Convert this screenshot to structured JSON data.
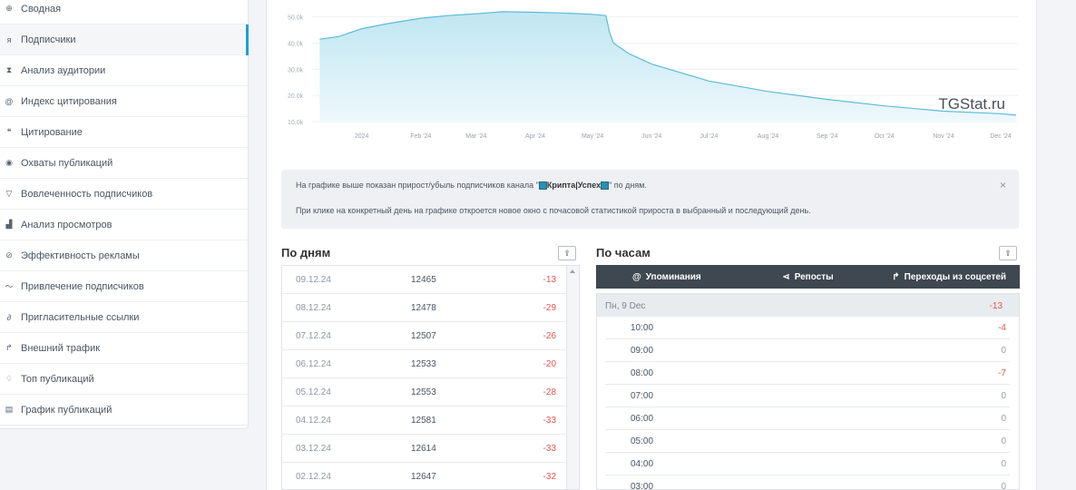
{
  "sidebar": {
    "items": [
      {
        "label": "Сводная",
        "icon": "dashboard-icon"
      },
      {
        "label": "Подписчики",
        "icon": "users-icon"
      },
      {
        "label": "Анализ аудитории",
        "icon": "hourglass-icon"
      },
      {
        "label": "Индекс цитирования",
        "icon": "at-icon"
      },
      {
        "label": "Цитирование",
        "icon": "quote-icon"
      },
      {
        "label": "Охваты публикаций",
        "icon": "eye-icon"
      },
      {
        "label": "Вовлеченность подписчиков",
        "icon": "filter-icon"
      },
      {
        "label": "Анализ просмотров",
        "icon": "bar-chart-icon"
      },
      {
        "label": "Эффективность рекламы",
        "icon": "tag-icon"
      },
      {
        "label": "Привлечение подписчиков",
        "icon": "trend-icon"
      },
      {
        "label": "Пригласительные ссылки",
        "icon": "link-icon"
      },
      {
        "label": "Внешний трафик",
        "icon": "share-arrow-icon"
      },
      {
        "label": "Топ публикаций",
        "icon": "thumbs-up-icon"
      },
      {
        "label": "График публикаций",
        "icon": "calendar-icon"
      }
    ]
  },
  "chart_data": {
    "type": "area",
    "x": [
      "2023-12-10",
      "2023-12-20",
      "2024-01-01",
      "2024-01-15",
      "2024-02-01",
      "2024-02-15",
      "2024-03-01",
      "2024-03-15",
      "2024-04-01",
      "2024-04-15",
      "2024-05-01",
      "2024-05-08",
      "2024-05-10",
      "2024-05-12",
      "2024-05-20",
      "2024-06-01",
      "2024-07-01",
      "2024-08-01",
      "2024-09-01",
      "2024-10-01",
      "2024-11-01",
      "2024-12-01",
      "2024-12-09"
    ],
    "y": [
      41500,
      42500,
      45500,
      47500,
      49500,
      50500,
      51200,
      52000,
      51800,
      51500,
      51000,
      50500,
      44000,
      40000,
      36000,
      32000,
      25500,
      21500,
      18500,
      16000,
      14000,
      13000,
      12465
    ],
    "ylim": [
      10000,
      53000
    ],
    "y_ticks": [
      "50.0k",
      "40.0k",
      "30.0k",
      "20.0k",
      "10.0k"
    ],
    "y_tick_values": [
      50000,
      40000,
      30000,
      20000,
      10000
    ],
    "x_ticks": [
      "2024",
      "Feb '24",
      "Mar '24",
      "Apr '24",
      "May '24",
      "Jun '24",
      "Jul '24",
      "Aug '24",
      "Sep '24",
      "Oct '24",
      "Nov '24",
      "Dec '24"
    ],
    "x_tick_dates": [
      "2024-01-01",
      "2024-02-01",
      "2024-03-01",
      "2024-04-01",
      "2024-05-01",
      "2024-06-01",
      "2024-07-01",
      "2024-08-01",
      "2024-09-01",
      "2024-10-01",
      "2024-11-01",
      "2024-12-01"
    ],
    "watermark": "TGStat.ru",
    "line_color": "#5bbcd9",
    "fill_color": "#bfe6f2",
    "grid": true
  },
  "info": {
    "line1_prefix": "На графике выше показан прирост/убыль подписчиков канала \"",
    "channel": "Крипта|Успех",
    "line1_suffix": "\" по дням.",
    "line2": "При клике на конкретный день на графике откроется новое окно с почасовой статистикой прироста в выбранный и последующий день."
  },
  "days": {
    "title": "По дням",
    "rows": [
      {
        "date": "09.12.24",
        "value": "12465",
        "diff": "-13"
      },
      {
        "date": "08.12.24",
        "value": "12478",
        "diff": "-29"
      },
      {
        "date": "07.12.24",
        "value": "12507",
        "diff": "-26"
      },
      {
        "date": "06.12.24",
        "value": "12533",
        "diff": "-20"
      },
      {
        "date": "05.12.24",
        "value": "12553",
        "diff": "-28"
      },
      {
        "date": "04.12.24",
        "value": "12581",
        "diff": "-33"
      },
      {
        "date": "03.12.24",
        "value": "12614",
        "diff": "-33"
      },
      {
        "date": "02.12.24",
        "value": "12647",
        "diff": "-32"
      }
    ]
  },
  "hours": {
    "title": "По часам",
    "tabs": [
      {
        "label": "Упоминания",
        "icon": "at-icon"
      },
      {
        "label": "Репосты",
        "icon": "share-icon"
      },
      {
        "label": "Переходы из соцсетей",
        "icon": "share-arrow-icon"
      }
    ],
    "day_label": "Пн, 9 Dec",
    "day_total": "-13",
    "rows": [
      {
        "time": "10:00",
        "value": "-4"
      },
      {
        "time": "09:00",
        "value": "0"
      },
      {
        "time": "08:00",
        "value": "-7"
      },
      {
        "time": "07:00",
        "value": "0"
      },
      {
        "time": "06:00",
        "value": "0"
      },
      {
        "time": "05:00",
        "value": "0"
      },
      {
        "time": "04:00",
        "value": "0"
      },
      {
        "time": "03:00",
        "value": "0"
      }
    ]
  },
  "colors": {
    "accent": "#1aa0d8",
    "negative": "#e8554e",
    "tabs_bg": "#3f4750"
  }
}
